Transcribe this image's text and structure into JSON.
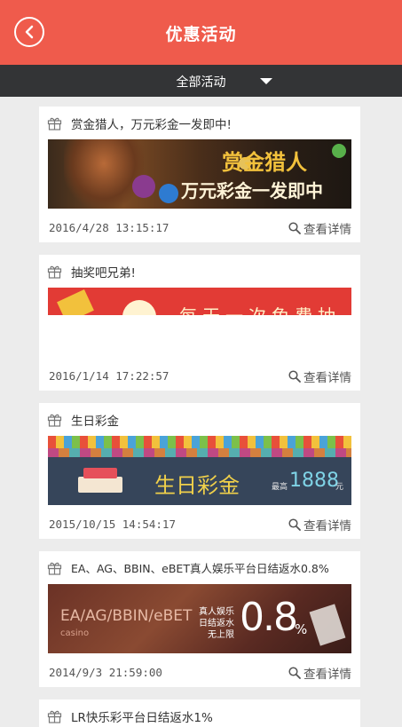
{
  "header": {
    "title": "优惠活动"
  },
  "filter": {
    "label": "全部活动"
  },
  "promos": [
    {
      "title": "赏金猎人，万元彩金一发即中!",
      "date": "2016/4/28 13:15:17",
      "detail": "查看详情",
      "banner": {
        "line1": "赏金猎人",
        "line2": "万元彩金一发即中"
      }
    },
    {
      "title": "抽奖吧兄弟!",
      "date": "2016/1/14 17:22:57",
      "detail": "查看详情",
      "banner": {
        "text": "每天一次免费抽奖"
      }
    },
    {
      "title": "生日彩金",
      "date": "2015/10/15 14:54:17",
      "detail": "查看详情",
      "banner": {
        "main": "生日彩金",
        "prefix": "最高",
        "amount": "1888",
        "unit": "元"
      }
    },
    {
      "title": "EA、AG、BBIN、eBET真人娱乐平台日结返水0.8%",
      "date": "2014/9/3 21:59:00",
      "detail": "查看详情",
      "banner": {
        "platforms": "EA/AG/BBIN/eBET",
        "sub": "casino",
        "line1": "真人娱乐",
        "line2": "日结返水",
        "line3": "无上限",
        "percent": "0.8"
      }
    },
    {
      "title": "LR快乐彩平台日结返水1%"
    }
  ],
  "colors": {
    "header": "#ef5b4c",
    "filterbar": "#333436",
    "background": "#ececec"
  }
}
